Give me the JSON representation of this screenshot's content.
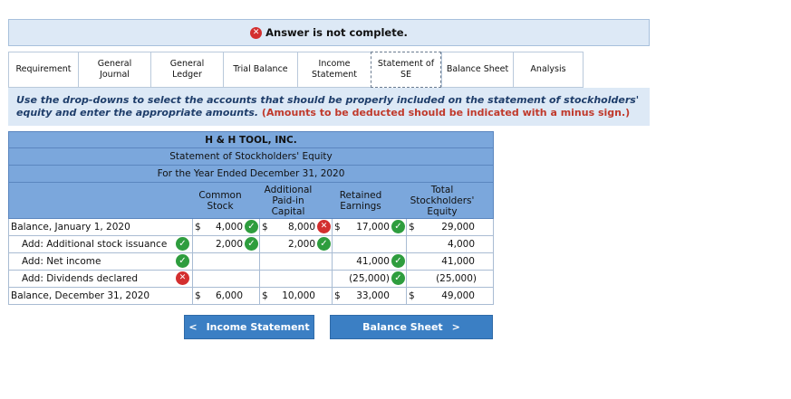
{
  "banner": {
    "text": "Answer is not complete."
  },
  "tabs": [
    {
      "label": "Requirement"
    },
    {
      "label": "General Journal"
    },
    {
      "label": "General Ledger"
    },
    {
      "label": "Trial Balance"
    },
    {
      "label": "Income Statement"
    },
    {
      "label": "Statement of SE",
      "active": true
    },
    {
      "label": "Balance Sheet"
    },
    {
      "label": "Analysis"
    }
  ],
  "instructions": {
    "text": "Use the drop-downs to select the accounts that should be properly included on the statement of stockholders' equity and enter the appropriate amounts.",
    "note": "(Amounts to be deducted should be indicated with a minus sign.)"
  },
  "statement": {
    "company": "H & H TOOL, INC.",
    "title": "Statement of Stockholders' Equity",
    "period": "For the Year Ended December 31, 2020",
    "columns": {
      "common": "Common Stock",
      "apic": "Additional Paid-in Capital",
      "retained": "Retained Earnings",
      "total": "Total Stockholders' Equity"
    },
    "rows": [
      {
        "label": "Balance, January 1, 2020",
        "common": "4,000",
        "apic": "8,000",
        "retained": "17,000",
        "total": "29,000"
      },
      {
        "label": "Add: Additional stock issuance",
        "common": "2,000",
        "apic": "2,000",
        "retained": "",
        "total": "4,000"
      },
      {
        "label": "Add: Net income",
        "common": "",
        "apic": "",
        "retained": "41,000",
        "total": "41,000"
      },
      {
        "label": "Add: Dividends declared",
        "common": "",
        "apic": "",
        "retained": "(25,000)",
        "total": "(25,000)"
      },
      {
        "label": "Balance, December 31, 2020",
        "common": "6,000",
        "apic": "10,000",
        "retained": "33,000",
        "total": "49,000"
      }
    ],
    "currency": "$"
  },
  "buttons": {
    "prev": "Income Statement",
    "next": "Balance Sheet"
  },
  "colors": {
    "header_blue": "#7ba7dc",
    "button_blue": "#3b7fc4",
    "check_green": "#2e9d3e",
    "x_red": "#d32f2f"
  }
}
